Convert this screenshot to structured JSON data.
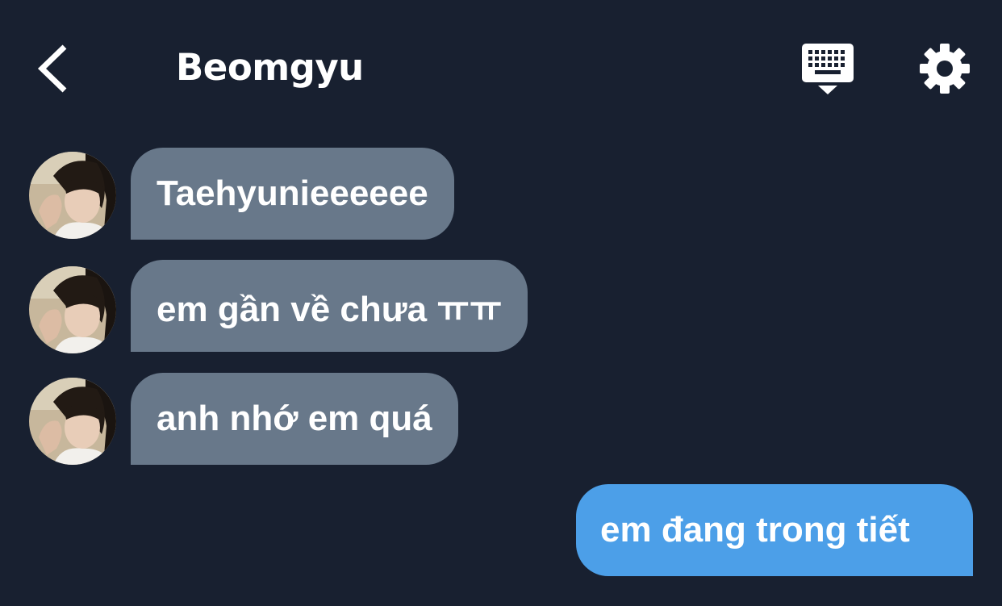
{
  "header": {
    "back_icon": "chevron-left-icon",
    "contact_name": "Beomgyu",
    "keyboard_icon": "keyboard-icon",
    "settings_icon": "gear-icon"
  },
  "messages": [
    {
      "sender": "Beomgyu",
      "direction": "incoming",
      "text": "Taehyunieeeeee"
    },
    {
      "sender": "Beomgyu",
      "direction": "incoming",
      "text": "em gần về chưa ㅠㅠ"
    },
    {
      "sender": "Beomgyu",
      "direction": "incoming",
      "text": "anh nhớ em quá"
    },
    {
      "sender": "me",
      "direction": "outgoing",
      "text": "em đang trong tiết"
    }
  ],
  "colors": {
    "background": "#182030",
    "incoming_bubble": "#68788a",
    "outgoing_bubble": "#4c9fe8",
    "text": "#ffffff"
  }
}
